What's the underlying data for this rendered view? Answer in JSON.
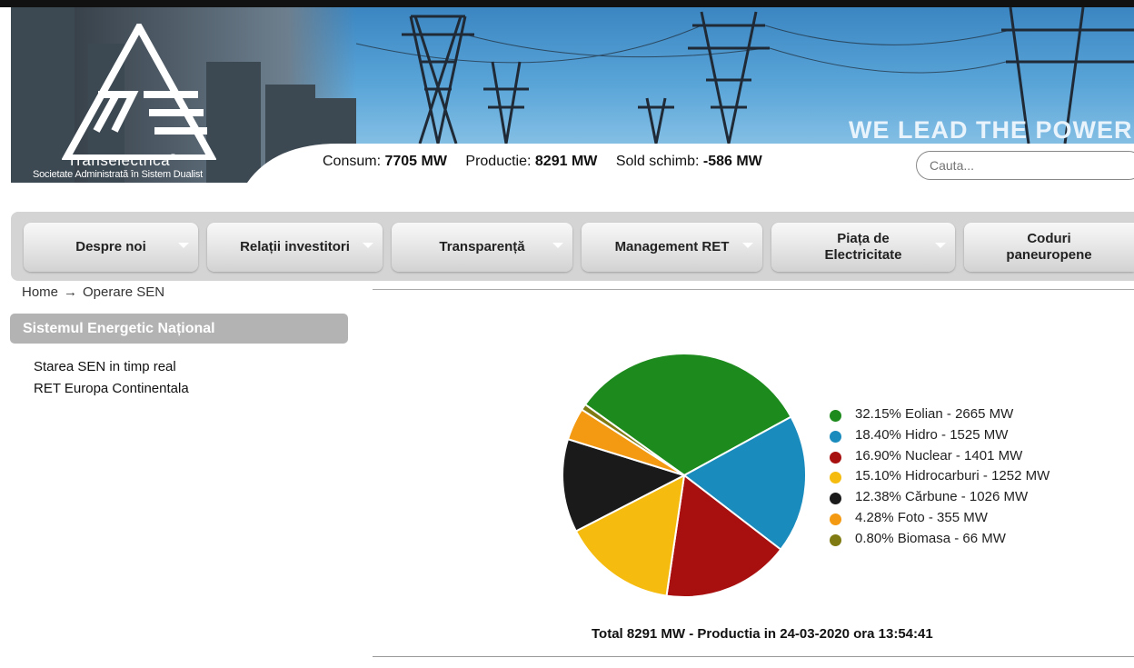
{
  "header": {
    "brand_name": "Transelectrica",
    "brand_reg": "®",
    "brand_tagline": "Societate Administrată în Sistem Dualist",
    "slogan": "WE LEAD THE POWER",
    "stats": [
      {
        "label": "Consum:",
        "value": "7705 MW"
      },
      {
        "label": "Productie:",
        "value": "8291 MW"
      },
      {
        "label": "Sold schimb:",
        "value": "-586 MW"
      }
    ],
    "search_placeholder": "Cauta..."
  },
  "nav": [
    {
      "label": "Despre noi"
    },
    {
      "label": "Relații investitori"
    },
    {
      "label": "Transparență"
    },
    {
      "label": "Management RET"
    },
    {
      "label": "Piața de Electricitate"
    },
    {
      "label": "Coduri paneuropene"
    }
  ],
  "breadcrumb": {
    "home": "Home",
    "separator": "→",
    "current": "Operare SEN"
  },
  "sidebar": {
    "title": "Sistemul Energetic Național",
    "links": [
      "Starea SEN in timp real",
      "RET Europa Continentala"
    ]
  },
  "chart_data": {
    "type": "pie",
    "slices": [
      {
        "label": "32.15% Eolian - 2665 MW",
        "name": "Eolian",
        "percent": 32.15,
        "value_mw": 2665,
        "color": "#1d8a1d"
      },
      {
        "label": "18.40% Hidro - 1525 MW",
        "name": "Hidro",
        "percent": 18.4,
        "value_mw": 1525,
        "color": "#1a8bbd"
      },
      {
        "label": "16.90% Nuclear - 1401 MW",
        "name": "Nuclear",
        "percent": 16.9,
        "value_mw": 1401,
        "color": "#a80f0f"
      },
      {
        "label": "15.10% Hidrocarburi - 1252 MW",
        "name": "Hidrocarburi",
        "percent": 15.1,
        "value_mw": 1252,
        "color": "#f5bc0f"
      },
      {
        "label": "12.38% Cărbune - 1026 MW",
        "name": "Cărbune",
        "percent": 12.38,
        "value_mw": 1026,
        "color": "#1a1a1a"
      },
      {
        "label": "4.28% Foto - 355 MW",
        "name": "Foto",
        "percent": 4.28,
        "value_mw": 355,
        "color": "#f39a12"
      },
      {
        "label": "0.80% Biomasa - 66 MW",
        "name": "Biomasa",
        "percent": 0.8,
        "value_mw": 66,
        "color": "#7f7a12"
      }
    ],
    "legend_position": "right",
    "footer": "Total 8291 MW - Productia in 24-03-2020 ora 13:54:41"
  }
}
